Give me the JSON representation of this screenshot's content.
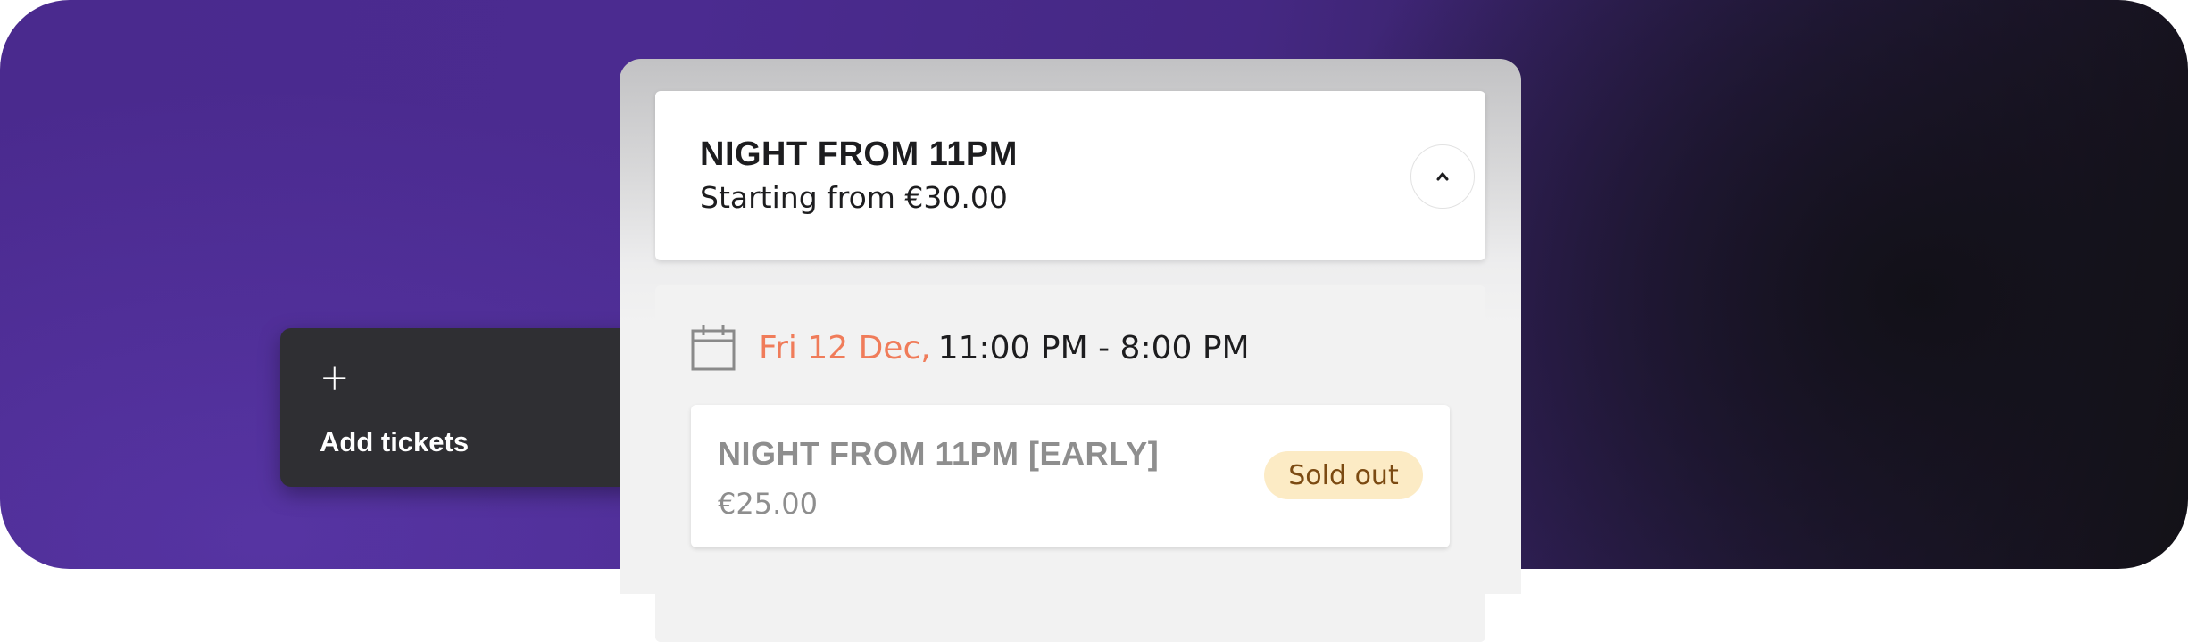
{
  "add_tickets": {
    "icon": "plus-icon",
    "label": "Add tickets"
  },
  "header": {
    "title": "NIGHT FROM 11PM",
    "subtitle": "Starting from €30.00",
    "collapse_icon": "chevron-up-icon"
  },
  "session": {
    "calendar_icon": "calendar-icon",
    "date": "Fri 12 Dec,",
    "time": "11:00 PM - 8:00 PM"
  },
  "tickets": [
    {
      "name": "NIGHT FROM 11PM [EARLY]",
      "price": "€25.00",
      "status": "Sold out"
    }
  ],
  "colors": {
    "accent_date": "#f07c5a",
    "sold_out_bg": "#fcebc5",
    "sold_out_text": "#7b4a12",
    "background": "#4a2a8e"
  }
}
